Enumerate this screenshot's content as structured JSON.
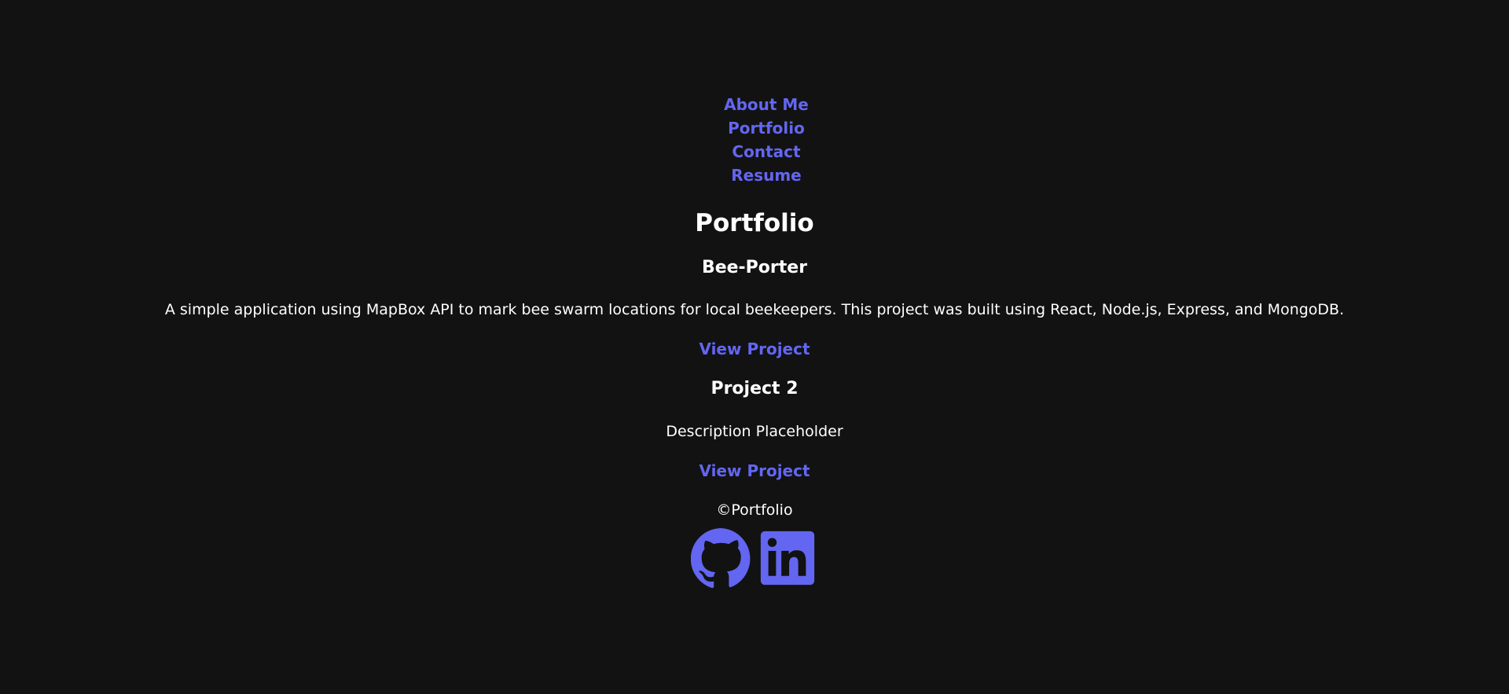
{
  "nav": {
    "items": [
      {
        "label": "About Me"
      },
      {
        "label": "Portfolio"
      },
      {
        "label": "Contact"
      },
      {
        "label": "Resume"
      }
    ]
  },
  "main": {
    "title": "Portfolio",
    "projects": [
      {
        "title": "Bee-Porter",
        "description": "A simple application using MapBox API to mark bee swarm locations for local beekeepers. This project was built using React, Node.js, Express, and MongoDB.",
        "link_label": "View Project"
      },
      {
        "title": "Project 2",
        "description": "Description Placeholder",
        "link_label": "View Project"
      }
    ]
  },
  "footer": {
    "text": "©Portfolio",
    "icons": [
      "github-icon",
      "linkedin-icon"
    ]
  },
  "colors": {
    "background": "#121212",
    "accent": "#6366f1",
    "text": "#ffffff"
  }
}
